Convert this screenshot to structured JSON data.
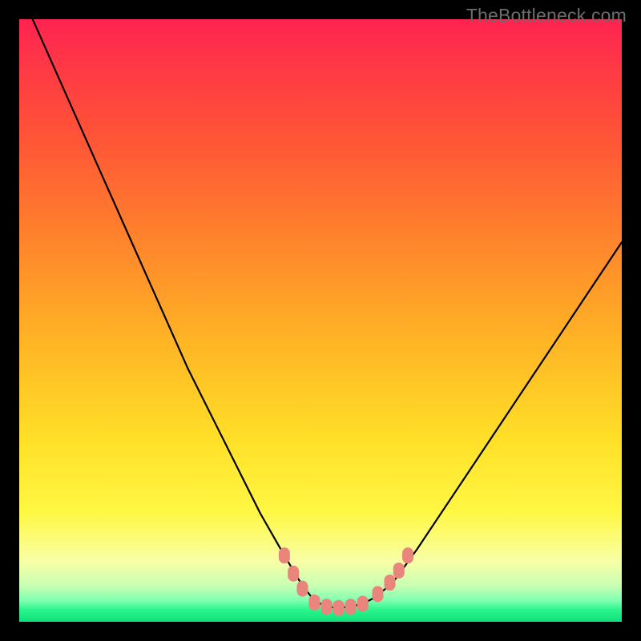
{
  "watermark": "TheBottleneck.com",
  "chart_data": {
    "type": "line",
    "title": "",
    "xlabel": "",
    "ylabel": "",
    "xlim": [
      0,
      100
    ],
    "ylim": [
      0,
      100
    ],
    "series": [
      {
        "name": "bottleneck-curve",
        "x": [
          0,
          4,
          8,
          12,
          16,
          20,
          24,
          28,
          32,
          36,
          40,
          44,
          47,
          49,
          51,
          53,
          55,
          57,
          59,
          62,
          66,
          70,
          76,
          82,
          88,
          94,
          100
        ],
        "y": [
          105,
          96,
          87,
          78,
          69,
          60,
          51,
          42,
          34,
          26,
          18,
          11,
          6,
          3.5,
          2.5,
          2.3,
          2.5,
          3.0,
          4.0,
          6.5,
          12,
          18,
          27,
          36,
          45,
          54,
          63
        ],
        "color": "#000000"
      }
    ],
    "markers": {
      "name": "well-markers",
      "color": "#e9857c",
      "shape": "rounded-rect",
      "points": [
        {
          "x": 44.0,
          "y": 11.0
        },
        {
          "x": 45.5,
          "y": 8.0
        },
        {
          "x": 47.0,
          "y": 5.5
        },
        {
          "x": 49.0,
          "y": 3.2
        },
        {
          "x": 51.0,
          "y": 2.5
        },
        {
          "x": 53.0,
          "y": 2.3
        },
        {
          "x": 55.0,
          "y": 2.5
        },
        {
          "x": 57.0,
          "y": 3.0
        },
        {
          "x": 59.5,
          "y": 4.6
        },
        {
          "x": 61.5,
          "y": 6.5
        },
        {
          "x": 63.0,
          "y": 8.5
        },
        {
          "x": 64.5,
          "y": 11.0
        }
      ]
    },
    "background_gradient": {
      "top": "#ff2350",
      "mid": "#ffe028",
      "bottom": "#0ee07b"
    }
  }
}
